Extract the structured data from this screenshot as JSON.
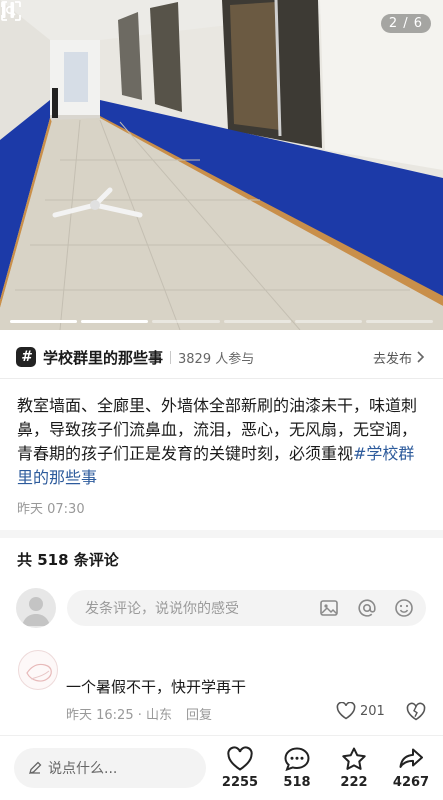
{
  "photo": {
    "page_counter": "2 / 6",
    "slides_total": 6,
    "slides_viewed": 2
  },
  "topic": {
    "badge": "#",
    "name": "学校群里的那些事",
    "participants": "3829 人参与",
    "go_label": "去发布"
  },
  "post": {
    "text": "教室墙面、全廊里、外墙体全部新刷的油漆未干，味道刺鼻，导致孩子们流鼻血，流泪，恶心，无风扇，无空调，青春期的孩子们正是发育的关键时刻，必须重视",
    "hashtag": "#学校群里的那些事",
    "time": "昨天 07:30"
  },
  "comments": {
    "count_label": "共 518 条评论",
    "input_placeholder": "发条评论，说说你的感受",
    "items": [
      {
        "text": "一个暑假不干，快开学再干",
        "time": "昨天 16:25 · 山东",
        "reply_label": "回复",
        "likes": "201"
      }
    ]
  },
  "bottom_bar": {
    "say_placeholder": "说点什么...",
    "like_count": "2255",
    "comment_count": "518",
    "favorite_count": "222",
    "share_count": "4267"
  },
  "colors": {
    "hashtag": "#2d5b9c",
    "wall_blue": "#1c3aa8",
    "muted_text": "#999999"
  }
}
